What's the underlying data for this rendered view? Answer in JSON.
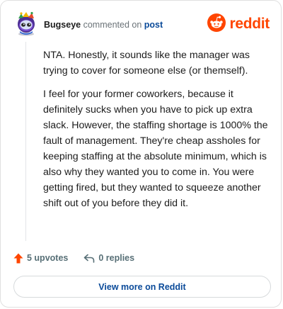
{
  "header": {
    "username": "Bugseye",
    "action_text": "commented on",
    "post_link": "post",
    "brand_name": "reddit",
    "brand_color": "#ff4500",
    "avatar_icon": "snoo-avatar-icon"
  },
  "comment": {
    "paragraphs": [
      "NTA. Honestly, it sounds like the manager was trying to cover for someone else (or themself).",
      "I feel for your former coworkers, because it definitely sucks when you have to pick up extra slack. However, the staffing shortage is 1000% the fault of management. They're cheap assholes for keeping staffing at the absolute minimum, which is also why they wanted you to come in. You were getting fired, but they wanted to squeeze another shift out of you before they did it."
    ]
  },
  "footer": {
    "upvotes_label": "5 upvotes",
    "replies_label": "0 replies",
    "upvote_icon": "upvote-arrow-icon",
    "reply_icon": "reply-arrow-icon",
    "upvote_color": "#ff4500"
  },
  "cta": {
    "view_more_label": "View more on Reddit",
    "link_color": "#0a4a99"
  }
}
